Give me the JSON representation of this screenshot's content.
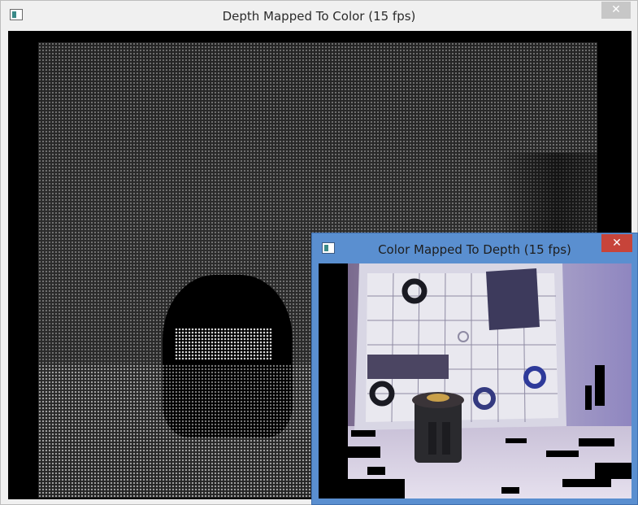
{
  "main_window": {
    "title": "Depth Mapped To Color (15 fps)",
    "close_glyph": "✕"
  },
  "overlay_window": {
    "title": "Color Mapped To Depth (15 fps)",
    "close_glyph": "✕"
  },
  "colors": {
    "active_titlebar": "#5a8fd0",
    "close_active": "#c7443a",
    "close_inactive": "#c7c7c7",
    "viewport_bg": "#000000"
  }
}
